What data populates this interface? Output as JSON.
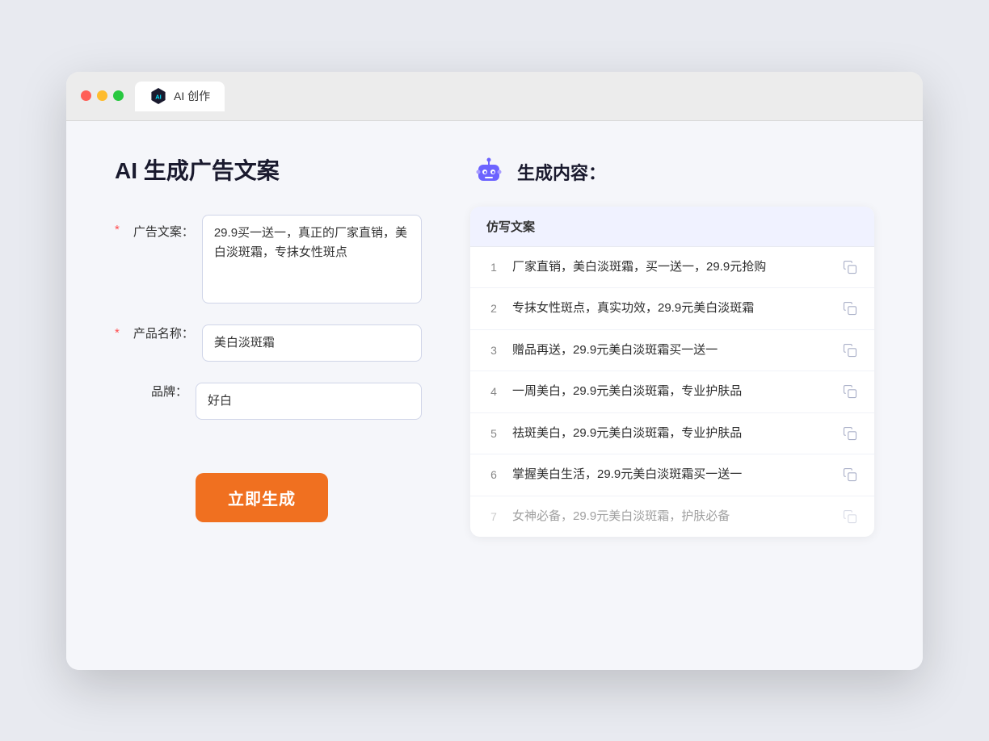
{
  "browser": {
    "tab_label": "AI 创作"
  },
  "page": {
    "title": "AI 生成广告文案",
    "right_title": "生成内容："
  },
  "form": {
    "ad_copy_label": "广告文案：",
    "ad_copy_value": "29.9买一送一，真正的厂家直销，美白淡斑霜，专抹女性斑点",
    "product_name_label": "产品名称：",
    "product_name_value": "美白淡斑霜",
    "brand_label": "品牌：",
    "brand_value": "好白",
    "generate_button": "立即生成"
  },
  "results": {
    "column_header": "仿写文案",
    "items": [
      {
        "num": "1",
        "text": "厂家直销，美白淡斑霜，买一送一，29.9元抢购",
        "faded": false
      },
      {
        "num": "2",
        "text": "专抹女性斑点，真实功效，29.9元美白淡斑霜",
        "faded": false
      },
      {
        "num": "3",
        "text": "赠品再送，29.9元美白淡斑霜买一送一",
        "faded": false
      },
      {
        "num": "4",
        "text": "一周美白，29.9元美白淡斑霜，专业护肤品",
        "faded": false
      },
      {
        "num": "5",
        "text": "祛斑美白，29.9元美白淡斑霜，专业护肤品",
        "faded": false
      },
      {
        "num": "6",
        "text": "掌握美白生活，29.9元美白淡斑霜买一送一",
        "faded": false
      },
      {
        "num": "7",
        "text": "女神必备，29.9元美白淡斑霜，护肤必备",
        "faded": true
      }
    ]
  }
}
